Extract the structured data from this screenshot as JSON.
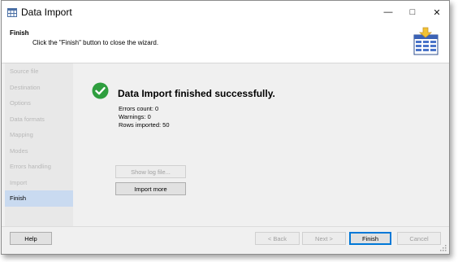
{
  "window": {
    "title": "Data Import"
  },
  "window_controls": {
    "minimize": "—",
    "maximize": "□",
    "close": "✕"
  },
  "header": {
    "title": "Finish",
    "subtitle": "Click the \"Finish\" button to close the wizard."
  },
  "sidebar": {
    "items": [
      {
        "label": "Source file",
        "state": "disabled"
      },
      {
        "label": "Destination",
        "state": "disabled"
      },
      {
        "label": "Options",
        "state": "disabled"
      },
      {
        "label": "Data formats",
        "state": "disabled"
      },
      {
        "label": "Mapping",
        "state": "disabled"
      },
      {
        "label": "Modes",
        "state": "disabled"
      },
      {
        "label": "Errors handling",
        "state": "disabled"
      },
      {
        "label": "Import",
        "state": "disabled"
      },
      {
        "label": "Finish",
        "state": "active"
      }
    ]
  },
  "result": {
    "title": "Data Import finished successfully.",
    "errors_count": "Errors count: 0",
    "warnings": "Warnings: 0",
    "rows_imported": "Rows imported: 50"
  },
  "actions": {
    "show_log": "Show log file...",
    "import_more": "Import more"
  },
  "footer": {
    "help": "Help",
    "back": "< Back",
    "next": "Next >",
    "finish": "Finish",
    "cancel": "Cancel"
  },
  "icons": {
    "app": "calendar-grid-icon",
    "success": "check-circle-icon",
    "header_graphic": "table-import-icon"
  },
  "colors": {
    "success_green": "#2e9e3e",
    "active_item": "#c9daf0",
    "default_button_border": "#0078d7"
  }
}
